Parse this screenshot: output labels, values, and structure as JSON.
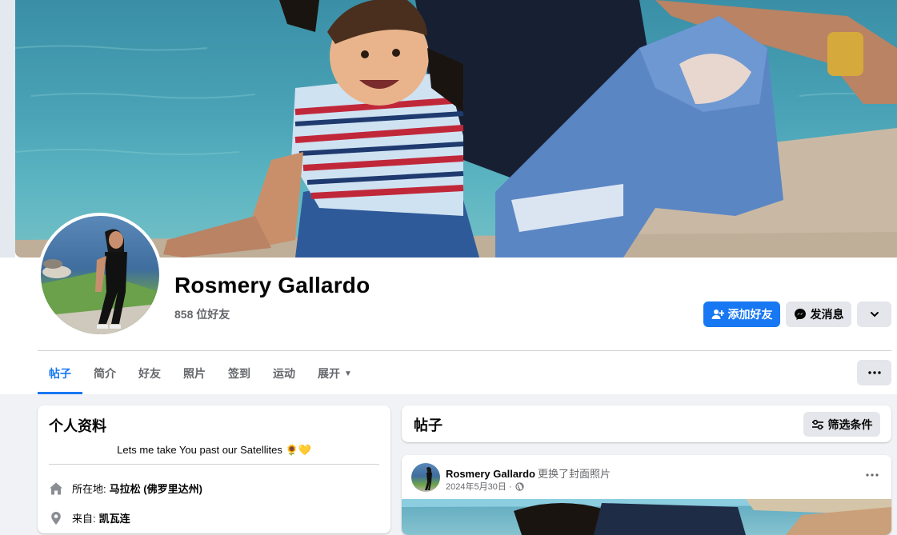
{
  "profile": {
    "name": "Rosmery Gallardo",
    "friend_count": "858 位好友"
  },
  "actions": {
    "add_friend": "添加好友",
    "message": "发消息"
  },
  "tabs": [
    {
      "label": "帖子"
    },
    {
      "label": "简介"
    },
    {
      "label": "好友"
    },
    {
      "label": "照片"
    },
    {
      "label": "签到"
    },
    {
      "label": "运动"
    },
    {
      "label": "展开"
    }
  ],
  "intro": {
    "title": "个人资料",
    "bio": "Lets me take You past our Satellites 🌻💛",
    "lives_label": "所在地:",
    "lives_value": "马拉松 (佛罗里达州)",
    "from_label": "来自:",
    "from_value": "凯瓦连"
  },
  "posts": {
    "title": "帖子",
    "filter_label": "筛选条件",
    "first_post": {
      "author": "Rosmery Gallardo",
      "action": "更换了封面照片",
      "date": "2024年5月30日 ·"
    }
  },
  "colors": {
    "primary": "#1877f2",
    "secondary_button": "#e4e6eb",
    "page_bg": "#f0f2f5",
    "muted_text": "#65676b"
  }
}
